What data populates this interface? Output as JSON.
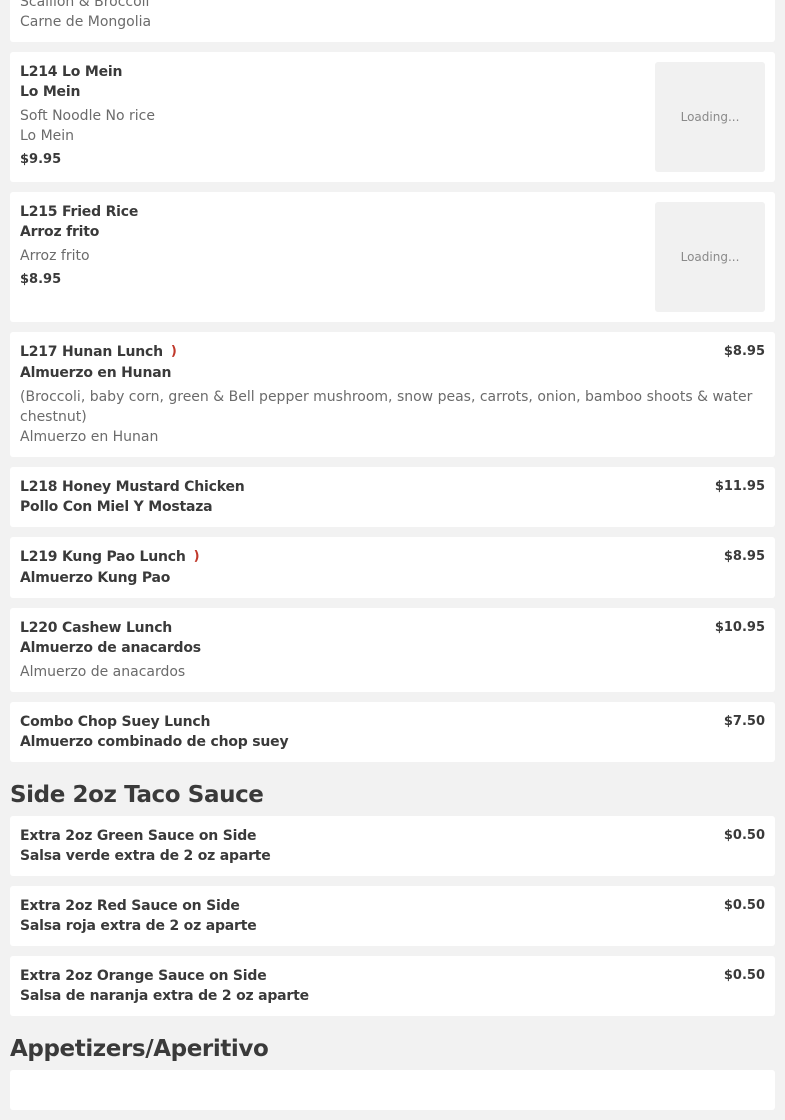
{
  "partial_card": {
    "lines": [
      "Scallion & Broccoli",
      "Carne de Mongolia"
    ]
  },
  "items_lunch": [
    {
      "title_en": "L214 Lo Mein",
      "title_es": "Lo Mein",
      "desc": [
        "Soft Noodle No rice",
        "Lo Mein"
      ],
      "price": "$9.95",
      "image_status": "Loading..."
    },
    {
      "title_en": "L215 Fried Rice",
      "title_es": "Arroz frito",
      "desc": [
        "Arroz frito"
      ],
      "price": "$8.95",
      "image_status": "Loading..."
    },
    {
      "title_en": "L217 Hunan Lunch",
      "title_es": "Almuerzo en Hunan",
      "spicy": true,
      "desc": [
        "(Broccoli, baby corn, green & Bell pepper mushroom, snow peas, carrots, onion, bamboo shoots & water chestnut)",
        "Almuerzo en Hunan"
      ],
      "price": "$8.95"
    },
    {
      "title_en": "L218 Honey Mustard Chicken",
      "title_es": "Pollo Con Miel Y Mostaza",
      "price": "$11.95"
    },
    {
      "title_en": "L219 Kung Pao Lunch",
      "title_es": "Almuerzo Kung Pao",
      "spicy": true,
      "price": "$8.95"
    },
    {
      "title_en": "L220 Cashew Lunch",
      "title_es": "Almuerzo de anacardos",
      "desc": [
        "Almuerzo de anacardos"
      ],
      "price": "$10.95"
    },
    {
      "title_en": "Combo Chop Suey Lunch",
      "title_es": "Almuerzo combinado de chop suey",
      "price": "$7.50"
    }
  ],
  "section_sauce": "Side 2oz Taco Sauce",
  "items_sauce": [
    {
      "title_en": "Extra 2oz Green Sauce on Side",
      "title_es": "Salsa verde extra de 2 oz aparte",
      "price": "$0.50"
    },
    {
      "title_en": "Extra 2oz Red Sauce on Side",
      "title_es": "Salsa roja extra de 2 oz aparte",
      "price": "$0.50"
    },
    {
      "title_en": "Extra 2oz Orange Sauce on Side",
      "title_es": "Salsa de naranja extra de 2 oz aparte",
      "price": "$0.50"
    }
  ],
  "section_appetizers": "Appetizers/Aperitivo",
  "spicy_icon": "chili-pepper-icon",
  "colors": {
    "background": "#f2f2f2",
    "card": "#ffffff",
    "text": "#3a3a3a",
    "muted": "#6b6b6b",
    "pepper": "#c0392b"
  }
}
